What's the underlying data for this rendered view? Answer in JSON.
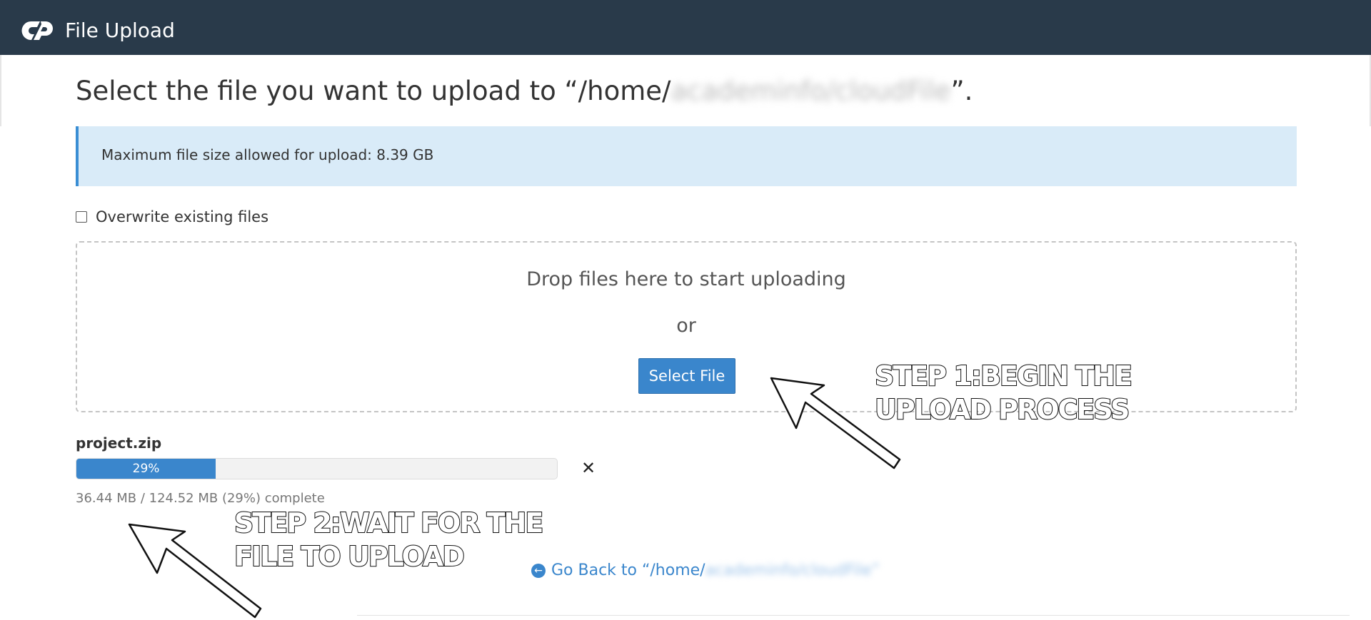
{
  "header": {
    "app_title": "File Upload",
    "logo": "cpanel-logo",
    "background_color": "#293a4a"
  },
  "page": {
    "heading_prefix": "Select the file you want to upload to “/home/",
    "heading_path_redacted": "academinfo/cloudFile",
    "heading_suffix": "”."
  },
  "alert": {
    "text": "Maximum file size allowed for upload: 8.39 GB"
  },
  "options": {
    "overwrite_label": "Overwrite existing files",
    "overwrite_checked": false
  },
  "dropzone": {
    "drop_text": "Drop files here to start uploading",
    "or_text": "or",
    "select_button": "Select File"
  },
  "upload": {
    "file_name": "project.zip",
    "progress_label": "29%",
    "progress_fraction": 0.29,
    "status_text": "36.44 MB / 124.52 MB (29%) complete",
    "cancel_icon": "close-icon"
  },
  "footer": {
    "back_prefix": "Go Back to “/home/",
    "back_path_redacted": "academinfo/cloudFile”",
    "back_icon": "arrow-circle-left-icon"
  },
  "annotations": {
    "step1_line1": "STEP 1:BEGIN THE",
    "step1_line2": "UPLOAD PROCESS",
    "step2_line1": "STEP 2:WAIT FOR THE",
    "step2_line2": "FILE TO UPLOAD"
  },
  "colors": {
    "accent": "#3a86cc",
    "alert_background": "#d9ebf8",
    "alert_border": "#3a8ed4"
  }
}
